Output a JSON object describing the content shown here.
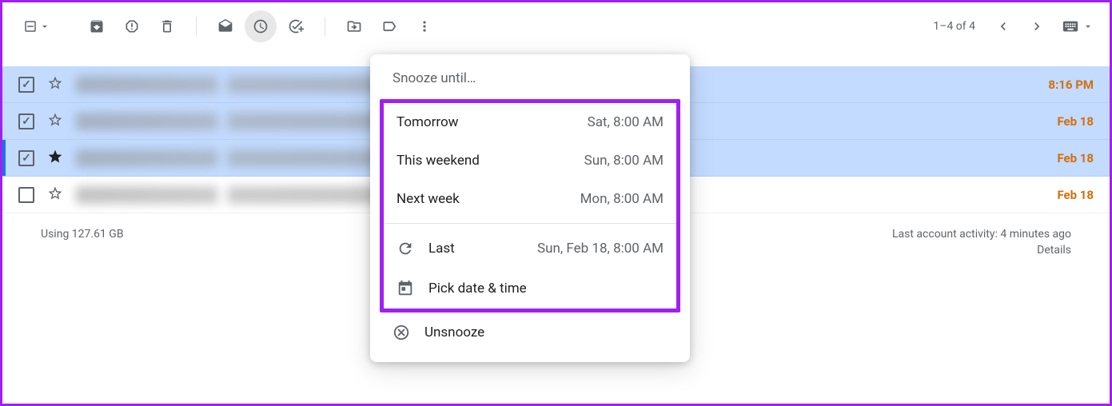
{
  "toolbar": {
    "pagination": "1–4 of 4"
  },
  "emails": [
    {
      "time": "8:16 PM",
      "selected": true,
      "checked": true,
      "starred": false,
      "highlighted": false
    },
    {
      "time": "Feb 18",
      "selected": true,
      "checked": true,
      "starred": false,
      "highlighted": false
    },
    {
      "time": "Feb 18",
      "selected": true,
      "checked": true,
      "starred": true,
      "highlighted": true
    },
    {
      "time": "Feb 18",
      "selected": false,
      "checked": false,
      "starred": false,
      "highlighted": false
    }
  ],
  "snooze": {
    "title": "Snooze until…",
    "options": [
      {
        "label": "Tomorrow",
        "time": "Sat, 8:00 AM"
      },
      {
        "label": "This weekend",
        "time": "Sun, 8:00 AM"
      },
      {
        "label": "Next week",
        "time": "Mon, 8:00 AM"
      }
    ],
    "last_label": "Last",
    "last_time": "Sun, Feb 18, 8:00 AM",
    "pick_label": "Pick date & time",
    "unsnooze_label": "Unsnooze"
  },
  "footer": {
    "storage": "Using 127.61 GB",
    "activity": "Last account activity: 4 minutes ago",
    "details": "Details"
  }
}
